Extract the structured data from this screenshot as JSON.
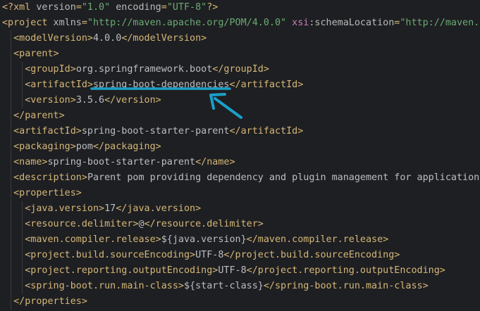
{
  "colors": {
    "background": "#1e1f22",
    "tag": "#d5b778",
    "attribute": "#bababa",
    "attribute_value": "#6aab73",
    "namespace_prefix": "#c77dbb",
    "text": "#bcbec4",
    "indent_guide": "#393b40",
    "annotation": "#1aa0c8"
  },
  "lines": [
    {
      "id": "l1",
      "indent": 0,
      "tokens": [
        {
          "k": "t",
          "s": "<?xml"
        },
        {
          "k": "a",
          "s": " version"
        },
        {
          "k": "t",
          "s": "="
        },
        {
          "k": "v",
          "s": "\"1.0\""
        },
        {
          "k": "a",
          "s": " encoding"
        },
        {
          "k": "t",
          "s": "="
        },
        {
          "k": "v",
          "s": "\"UTF-8\""
        },
        {
          "k": "t",
          "s": "?>"
        }
      ]
    },
    {
      "id": "l2",
      "indent": 0,
      "tokens": [
        {
          "k": "t",
          "s": "<project"
        },
        {
          "k": "a",
          "s": " xmlns"
        },
        {
          "k": "t",
          "s": "="
        },
        {
          "k": "v",
          "s": "\"http://maven.apache.org/POM/4.0.0\""
        },
        {
          "k": "ns",
          "s": " xsi"
        },
        {
          "k": "a",
          "s": ":schemaLocation"
        },
        {
          "k": "t",
          "s": "="
        },
        {
          "k": "v",
          "s": "\"http://maven.a"
        }
      ]
    },
    {
      "id": "l3",
      "indent": 1,
      "tokens": [
        {
          "k": "t",
          "s": "<modelVersion>"
        },
        {
          "k": "txt",
          "s": "4.0.0"
        },
        {
          "k": "t",
          "s": "</modelVersion>"
        }
      ]
    },
    {
      "id": "l4",
      "indent": 1,
      "tokens": [
        {
          "k": "t",
          "s": "<parent>"
        }
      ]
    },
    {
      "id": "l5",
      "indent": 2,
      "tokens": [
        {
          "k": "t",
          "s": "<groupId>"
        },
        {
          "k": "txt",
          "s": "org.springframework.boot"
        },
        {
          "k": "t",
          "s": "</groupId>"
        }
      ]
    },
    {
      "id": "l6",
      "indent": 2,
      "tokens": [
        {
          "k": "t",
          "s": "<artifactId>"
        },
        {
          "k": "txt",
          "s": "spring-boot-dependencies",
          "name": "highlighted-artifact-id"
        },
        {
          "k": "t",
          "s": "</artifactId>"
        }
      ]
    },
    {
      "id": "l7",
      "indent": 2,
      "tokens": [
        {
          "k": "t",
          "s": "<version>"
        },
        {
          "k": "txt",
          "s": "3.5.6"
        },
        {
          "k": "t",
          "s": "</version>"
        }
      ]
    },
    {
      "id": "l8",
      "indent": 1,
      "tokens": [
        {
          "k": "t",
          "s": "</parent>"
        }
      ]
    },
    {
      "id": "l9",
      "indent": 1,
      "tokens": [
        {
          "k": "t",
          "s": "<artifactId>"
        },
        {
          "k": "txt",
          "s": "spring-boot-starter-parent"
        },
        {
          "k": "t",
          "s": "</artifactId>"
        }
      ]
    },
    {
      "id": "l10",
      "indent": 1,
      "tokens": [
        {
          "k": "t",
          "s": "<packaging>"
        },
        {
          "k": "txt",
          "s": "pom"
        },
        {
          "k": "t",
          "s": "</packaging>"
        }
      ]
    },
    {
      "id": "l11",
      "indent": 1,
      "tokens": [
        {
          "k": "t",
          "s": "<name>"
        },
        {
          "k": "txt",
          "s": "spring-boot-starter-parent"
        },
        {
          "k": "t",
          "s": "</name>"
        }
      ]
    },
    {
      "id": "l12",
      "indent": 1,
      "tokens": [
        {
          "k": "t",
          "s": "<description>"
        },
        {
          "k": "txt",
          "s": "Parent pom providing dependency and plugin management for applications"
        }
      ]
    },
    {
      "id": "l13",
      "indent": 1,
      "tokens": [
        {
          "k": "t",
          "s": "<properties>"
        }
      ]
    },
    {
      "id": "l14",
      "indent": 2,
      "tokens": [
        {
          "k": "t",
          "s": "<java.version>"
        },
        {
          "k": "txt",
          "s": "17"
        },
        {
          "k": "t",
          "s": "</java.version>"
        }
      ]
    },
    {
      "id": "l15",
      "indent": 2,
      "tokens": [
        {
          "k": "t",
          "s": "<resource.delimiter>"
        },
        {
          "k": "txt",
          "s": "@"
        },
        {
          "k": "t",
          "s": "</resource.delimiter>"
        }
      ]
    },
    {
      "id": "l16",
      "indent": 2,
      "tokens": [
        {
          "k": "t",
          "s": "<maven.compiler.release>"
        },
        {
          "k": "txt",
          "s": "${java.version}"
        },
        {
          "k": "t",
          "s": "</maven.compiler.release>"
        }
      ]
    },
    {
      "id": "l17",
      "indent": 2,
      "tokens": [
        {
          "k": "t",
          "s": "<project.build.sourceEncoding>"
        },
        {
          "k": "txt",
          "s": "UTF-8"
        },
        {
          "k": "t",
          "s": "</project.build.sourceEncoding>"
        }
      ]
    },
    {
      "id": "l18",
      "indent": 2,
      "tokens": [
        {
          "k": "t",
          "s": "<project.reporting.outputEncoding>"
        },
        {
          "k": "txt",
          "s": "UTF-8"
        },
        {
          "k": "t",
          "s": "</project.reporting.outputEncoding>"
        }
      ]
    },
    {
      "id": "l19",
      "indent": 2,
      "tokens": [
        {
          "k": "t",
          "s": "<spring-boot.run.main-class>"
        },
        {
          "k": "txt",
          "s": "${start-class}"
        },
        {
          "k": "t",
          "s": "</spring-boot.run.main-class>"
        }
      ]
    },
    {
      "id": "l20",
      "indent": 1,
      "tokens": [
        {
          "k": "t",
          "s": "</properties>"
        }
      ]
    }
  ],
  "annotation": {
    "type": "underline-and-arrow",
    "target": "highlighted-artifact-id",
    "icon": "arrow-icon"
  }
}
